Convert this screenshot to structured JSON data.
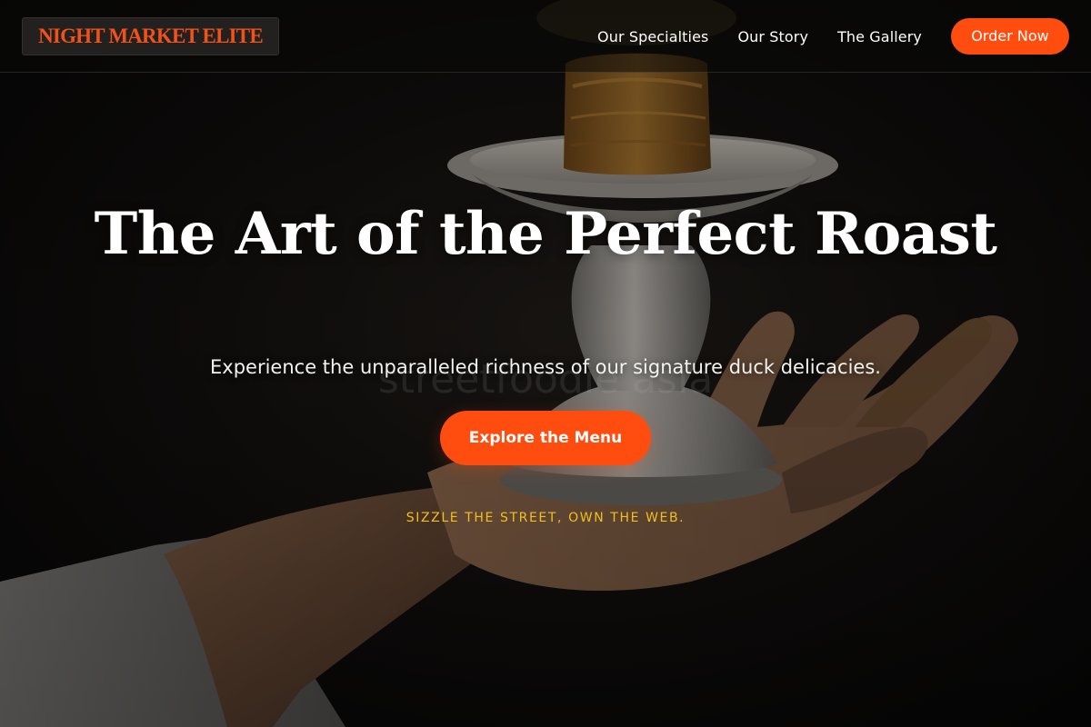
{
  "brand": {
    "logo_text": "NIGHT MARKET ELITE"
  },
  "nav": {
    "items": [
      {
        "label": "Our Specialties"
      },
      {
        "label": "Our Story"
      },
      {
        "label": "The Gallery"
      }
    ],
    "cta_label": "Order Now"
  },
  "hero": {
    "title": "The Art of the Perfect Roast",
    "subtitle": "Experience the unparalleled richness of our signature duck delicacies.",
    "button_label": "Explore the Menu",
    "tagline": "SIZZLE THE STREET, OWN THE WEB.",
    "background_image": "hand-holding-plated-roast-on-pedestal-dish-photo",
    "watermark": "streetfoodie asia"
  },
  "colors": {
    "accent": "#ff4d0f",
    "logo_text": "#f2511a",
    "tagline": "#f2bf1c",
    "header_bg": "#0a0908",
    "page_bg": "#0b0a09"
  }
}
